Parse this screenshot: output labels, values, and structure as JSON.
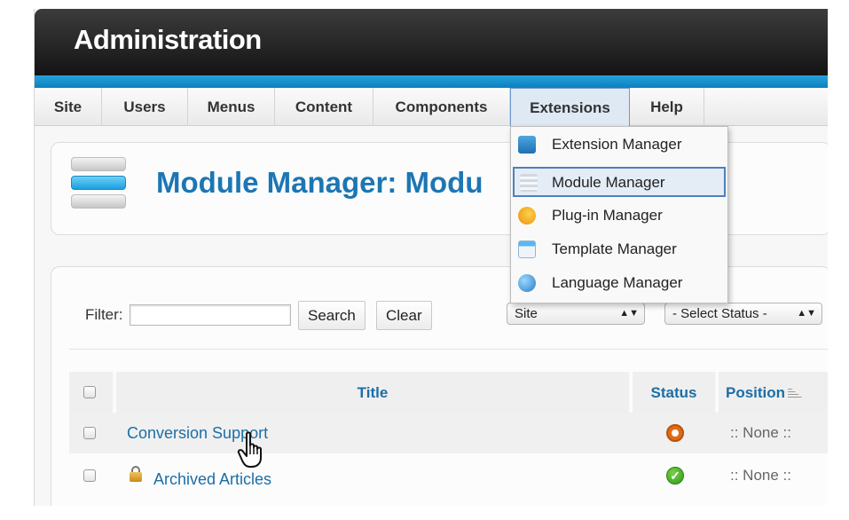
{
  "header": {
    "title": "Administration"
  },
  "menu": {
    "items": [
      {
        "label": "Site"
      },
      {
        "label": "Users"
      },
      {
        "label": "Menus"
      },
      {
        "label": "Content"
      },
      {
        "label": "Components"
      },
      {
        "label": "Extensions"
      },
      {
        "label": "Help"
      }
    ],
    "active": "Extensions"
  },
  "extensions_menu": {
    "items": [
      {
        "label": "Extension Manager",
        "icon": "extension-icon"
      },
      {
        "label": "Module Manager",
        "icon": "module-icon"
      },
      {
        "label": "Plug-in Manager",
        "icon": "plugin-icon"
      },
      {
        "label": "Template Manager",
        "icon": "template-icon"
      },
      {
        "label": "Language Manager",
        "icon": "language-icon"
      }
    ],
    "highlighted": "Module Manager"
  },
  "page": {
    "title": "Module Manager: Modu"
  },
  "filter": {
    "label": "Filter:",
    "value": "",
    "search_label": "Search",
    "clear_label": "Clear",
    "client_select": "Site",
    "status_select": "- Select Status -"
  },
  "table": {
    "headers": {
      "title": "Title",
      "status": "Status",
      "position": "Position"
    },
    "rows": [
      {
        "title": "Conversion Support",
        "status": "unpublished",
        "position": ":: None ::",
        "locked": false
      },
      {
        "title": "Archived Articles",
        "status": "published",
        "position": ":: None ::",
        "locked": true
      }
    ]
  },
  "colors": {
    "brand_blue": "#1c76b4",
    "header_dark": "#1e1e1e",
    "accent_strip": "#1a93d3",
    "status_unpublished": "#e06b16",
    "status_published": "#3aa622"
  }
}
